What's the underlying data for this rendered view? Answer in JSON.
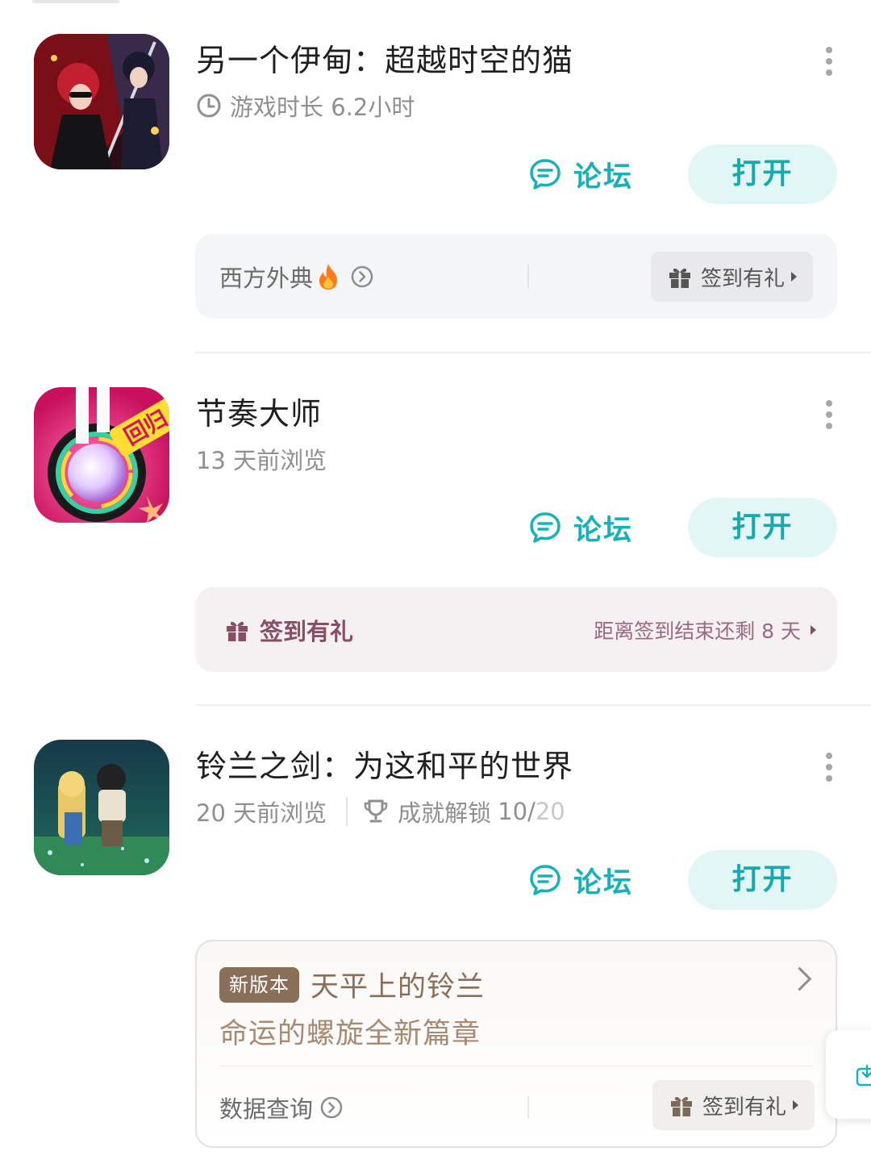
{
  "games": [
    {
      "title": "另一个伊甸：超越时空的猫",
      "subtitle": "游戏时长 6.2小时",
      "forum_label": "论坛",
      "open_label": "打开",
      "panel": {
        "left_text": "西方外典",
        "sign_label": "签到有礼"
      }
    },
    {
      "title": "节奏大师",
      "subtitle": "13 天前浏览",
      "forum_label": "论坛",
      "open_label": "打开",
      "icon_text": "回归",
      "panel": {
        "sign_label": "签到有礼",
        "right_text": "距离签到结束还剩 8 天"
      }
    },
    {
      "title": "铃兰之剑：为这和平的世界",
      "subtitle": "20 天前浏览",
      "achievement_label": "成就解锁",
      "achievement_done": "10/",
      "achievement_total": "20",
      "forum_label": "论坛",
      "open_label": "打开",
      "card": {
        "badge": "新版本",
        "title": "天平上的铃兰",
        "subtitle": "命运的螺旋全新篇章",
        "left_text": "数据查询",
        "sign_label": "签到有礼"
      }
    }
  ],
  "colors": {
    "accent": "#17b2b7",
    "open_bg": "#e2f6f6",
    "pink_text": "#8a4d66",
    "gold_text": "#8a6f58"
  }
}
